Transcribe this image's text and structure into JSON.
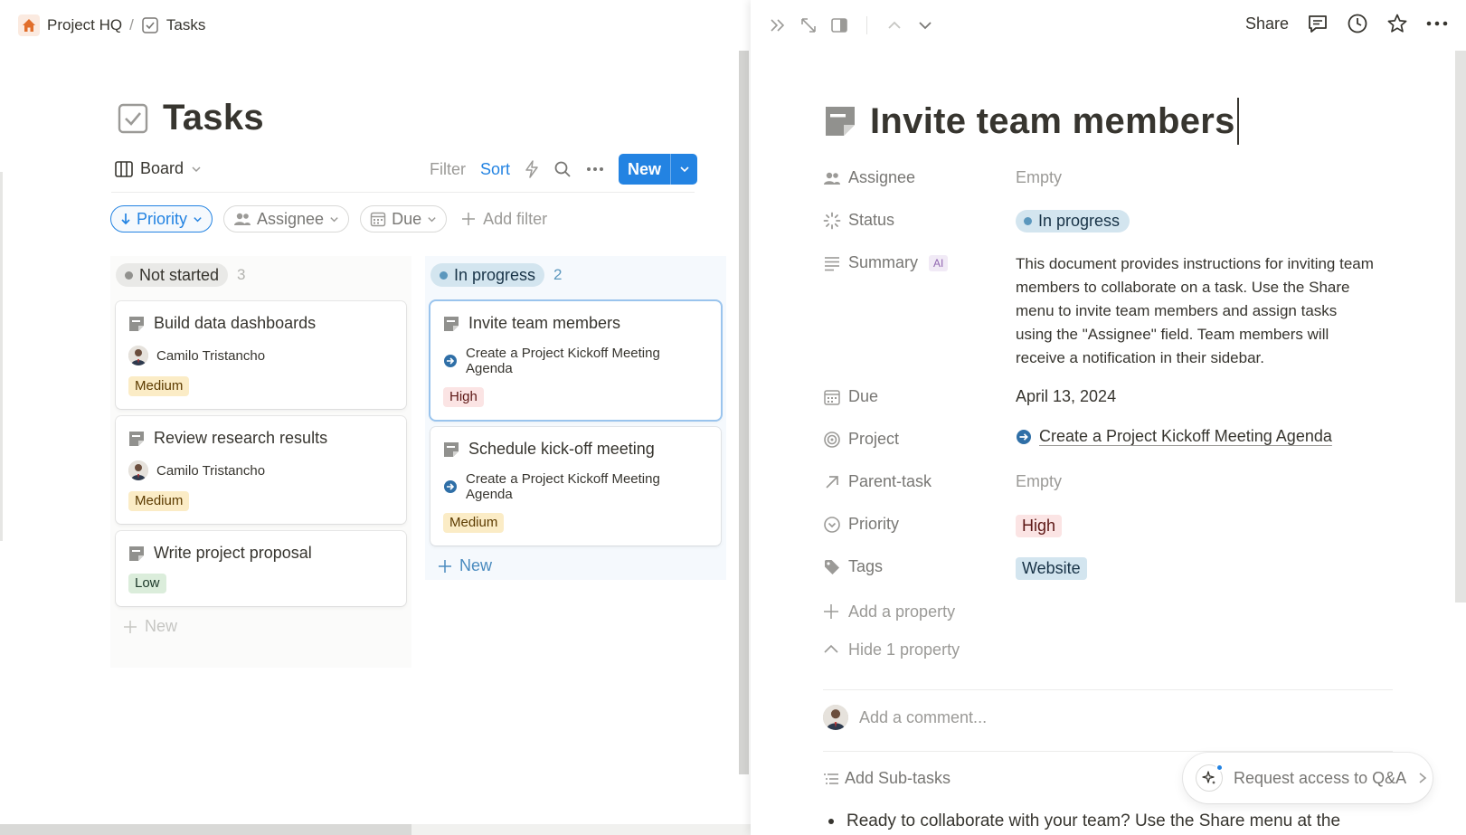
{
  "breadcrumb": {
    "workspace": "Project HQ",
    "separator": "/",
    "page": "Tasks"
  },
  "database": {
    "title": "Tasks",
    "view_label": "Board",
    "toolbar": {
      "filter": "Filter",
      "sort": "Sort",
      "new": "New"
    },
    "filters": {
      "priority": "Priority",
      "assignee": "Assignee",
      "due": "Due",
      "add_filter": "Add filter"
    },
    "columns": [
      {
        "status": "Not started",
        "count": "3",
        "cards": [
          {
            "title": "Build data dashboards",
            "assignee": "Camilo Tristancho",
            "priority": "Medium"
          },
          {
            "title": "Review research results",
            "assignee": "Camilo Tristancho",
            "priority": "Medium"
          },
          {
            "title": "Write project proposal",
            "priority": "Low"
          }
        ],
        "new_label": "New"
      },
      {
        "status": "In progress",
        "count": "2",
        "cards": [
          {
            "title": "Invite team members",
            "project": "Create a Project Kickoff Meeting Agenda",
            "priority": "High"
          },
          {
            "title": "Schedule kick-off meeting",
            "project": "Create a Project Kickoff Meeting Agenda",
            "priority": "Medium"
          }
        ],
        "new_label": "New"
      }
    ]
  },
  "peek": {
    "topbar": {
      "share": "Share"
    },
    "title": "Invite team members",
    "properties": {
      "assignee": {
        "label": "Assignee",
        "value": "Empty"
      },
      "status": {
        "label": "Status",
        "value": "In progress"
      },
      "summary": {
        "label": "Summary",
        "badge": "AI",
        "value": "This document provides instructions for inviting team members to collaborate on a task. Use the Share menu to invite team members and assign tasks using the \"Assignee\" field. Team members will receive a notification in their sidebar."
      },
      "due": {
        "label": "Due",
        "value": "April 13, 2024"
      },
      "project": {
        "label": "Project",
        "value": "Create a Project Kickoff Meeting Agenda"
      },
      "parent_task": {
        "label": "Parent-task",
        "value": "Empty"
      },
      "priority": {
        "label": "Priority",
        "value": "High"
      },
      "tags": {
        "label": "Tags",
        "value": "Website"
      }
    },
    "add_property": "Add a property",
    "hide_property": "Hide 1 property",
    "comment_placeholder": "Add a comment...",
    "add_subtasks": "Add Sub-tasks",
    "body_line": "Ready to collaborate with your team? Use the Share menu at the",
    "qa_button": "Request access to Q&A"
  },
  "colors": {
    "accent": "#2383e2",
    "status_in_progress_bg": "#d3e5ef",
    "tag_medium_bg": "#fbecc6",
    "tag_high_bg": "#fbe4e4",
    "tag_low_bg": "#dbeddb"
  },
  "icons": [
    "home-icon",
    "checkbox-icon",
    "board-icon",
    "bolt-icon",
    "search-icon",
    "more-icon",
    "doc-icon",
    "arrow-circle-icon",
    "chevrons-right-icon",
    "expand-icon",
    "sidebar-icon",
    "chevron-up-icon",
    "chevron-down-icon",
    "comment-icon",
    "clock-icon",
    "star-icon",
    "sparkle-icon"
  ]
}
